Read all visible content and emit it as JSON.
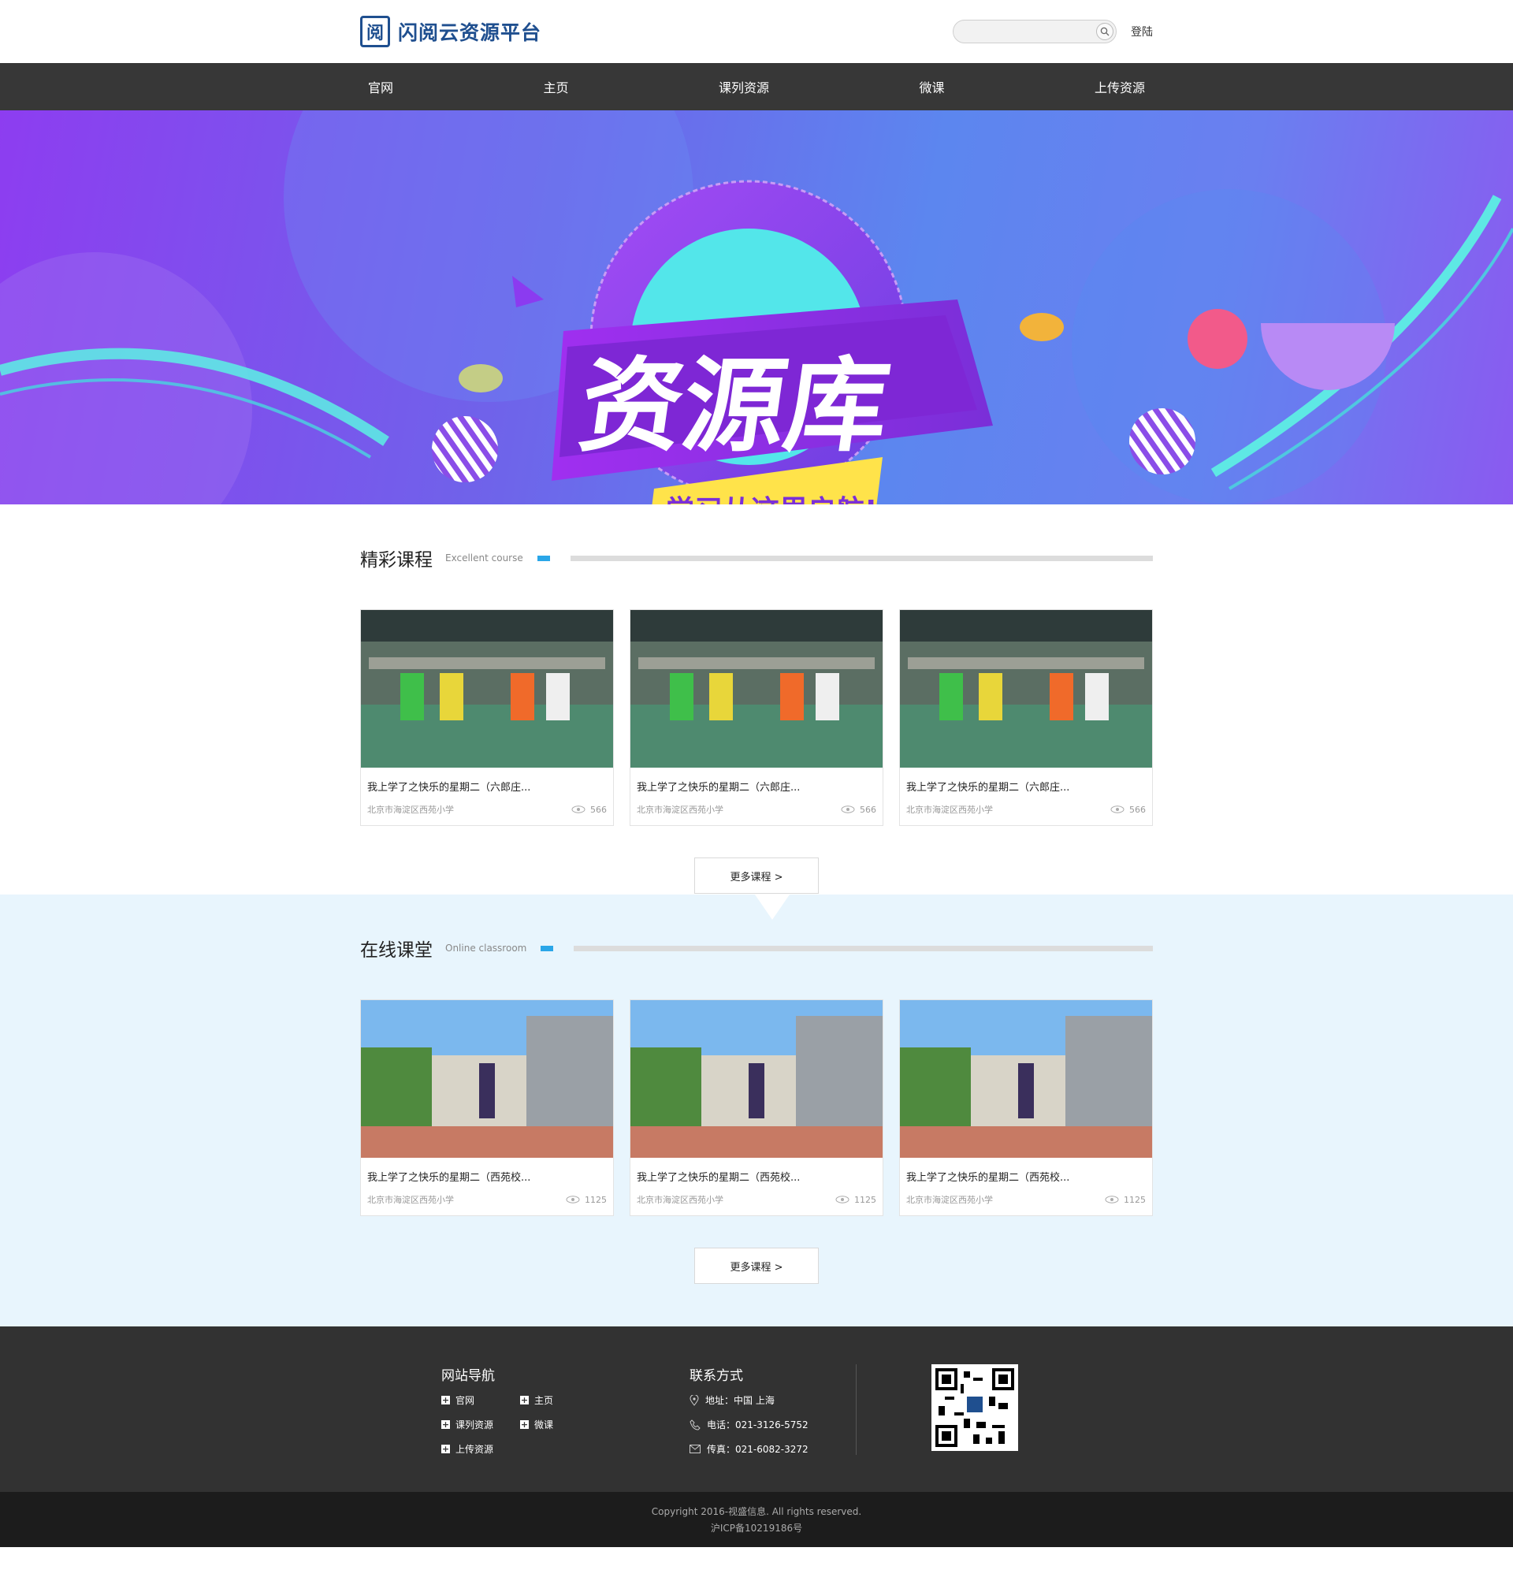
{
  "header": {
    "logo_text": "闪阅云资源平台",
    "search_placeholder": "",
    "login_label": "登陆"
  },
  "nav": {
    "items": [
      "官网",
      "主页",
      "课列资源",
      "微课",
      "上传资源"
    ]
  },
  "banner": {
    "title": "资源库",
    "subtitle": "学习从这里启航!"
  },
  "section_courses": {
    "title_cn": "精彩课程",
    "title_en": "Excellent course",
    "cards": [
      {
        "title": "我上学了之快乐的星期二（六郎庄...",
        "school": "北京市海淀区西苑小学",
        "views": "566"
      },
      {
        "title": "我上学了之快乐的星期二（六郎庄...",
        "school": "北京市海淀区西苑小学",
        "views": "566"
      },
      {
        "title": "我上学了之快乐的星期二（六郎庄...",
        "school": "北京市海淀区西苑小学",
        "views": "566"
      }
    ],
    "more_label": "更多课程 >"
  },
  "section_online": {
    "title_cn": "在线课堂",
    "title_en": "Online classroom",
    "cards": [
      {
        "title": "我上学了之快乐的星期二（西苑校...",
        "school": "北京市海淀区西苑小学",
        "views": "1125"
      },
      {
        "title": "我上学了之快乐的星期二（西苑校...",
        "school": "北京市海淀区西苑小学",
        "views": "1125"
      },
      {
        "title": "我上学了之快乐的星期二（西苑校...",
        "school": "北京市海淀区西苑小学",
        "views": "1125"
      }
    ],
    "more_label": "更多课程 >"
  },
  "footer": {
    "nav_title": "网站导航",
    "nav_links": [
      "官网",
      "主页",
      "课列资源",
      "微课",
      "上传资源"
    ],
    "contact_title": "联系方式",
    "address": "地址：中国 上海",
    "phone": "电话：021-3126-5752",
    "fax": "传真：021-6082-3272",
    "copyright": "Copyright 2016-视盛信息. All rights reserved.",
    "icp": "沪ICP备10219186号"
  },
  "colors": {
    "brand": "#1f4f8f",
    "nav_bg": "#373737",
    "accent": "#2aa6e8",
    "section2_bg": "#e8f5fd",
    "footer_bg": "#323232"
  }
}
